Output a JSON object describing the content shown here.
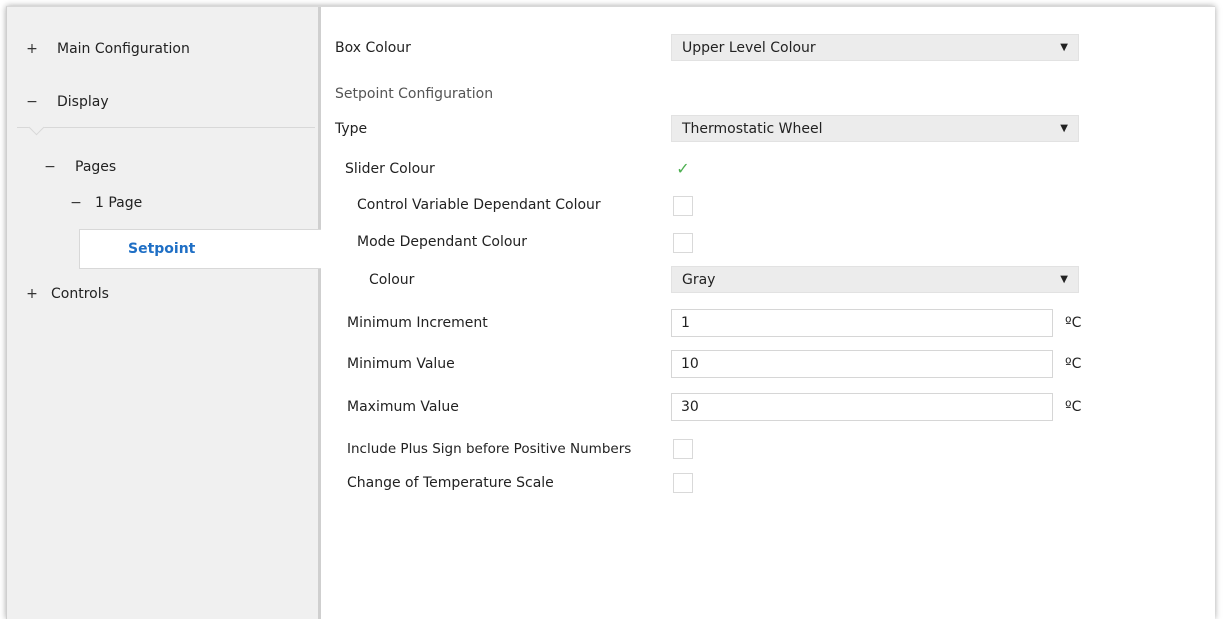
{
  "sidebar": {
    "items": [
      {
        "symbol": "+",
        "label": "Main Configuration"
      },
      {
        "symbol": "−",
        "label": "Display"
      },
      {
        "symbol": "−",
        "label": "Pages"
      },
      {
        "symbol": "−",
        "label": "1 Page"
      },
      {
        "symbol": "",
        "label": "Setpoint"
      },
      {
        "symbol": "+",
        "label": "Controls"
      }
    ]
  },
  "form": {
    "box_colour": {
      "label": "Box Colour",
      "value": "Upper Level Colour"
    },
    "section_title": "Setpoint Configuration",
    "type": {
      "label": "Type",
      "value": "Thermostatic Wheel"
    },
    "slider_colour": {
      "label": "Slider Colour",
      "checked": true
    },
    "control_variable_dependant": {
      "label": "Control Variable Dependant Colour",
      "checked": false
    },
    "mode_dependant": {
      "label": "Mode Dependant Colour",
      "checked": false
    },
    "colour": {
      "label": "Colour",
      "value": "Gray"
    },
    "minimum_increment": {
      "label": "Minimum Increment",
      "value": "1",
      "unit": "ºC"
    },
    "minimum_value": {
      "label": "Minimum Value",
      "value": "10",
      "unit": "ºC"
    },
    "maximum_value": {
      "label": "Maximum Value",
      "value": "30",
      "unit": "ºC"
    },
    "plus_sign": {
      "label": "Include Plus Sign before Positive Numbers",
      "checked": false
    },
    "temp_scale": {
      "label": "Change of Temperature Scale",
      "checked": false
    },
    "tick_glyph": "✓",
    "dropdown_glyph": "▼"
  },
  "colors": {
    "selected_text": "#1f6fc5",
    "check_green": "#4caf50",
    "sidebar_bg": "#f0f0f0",
    "select_bg": "#ececec"
  }
}
